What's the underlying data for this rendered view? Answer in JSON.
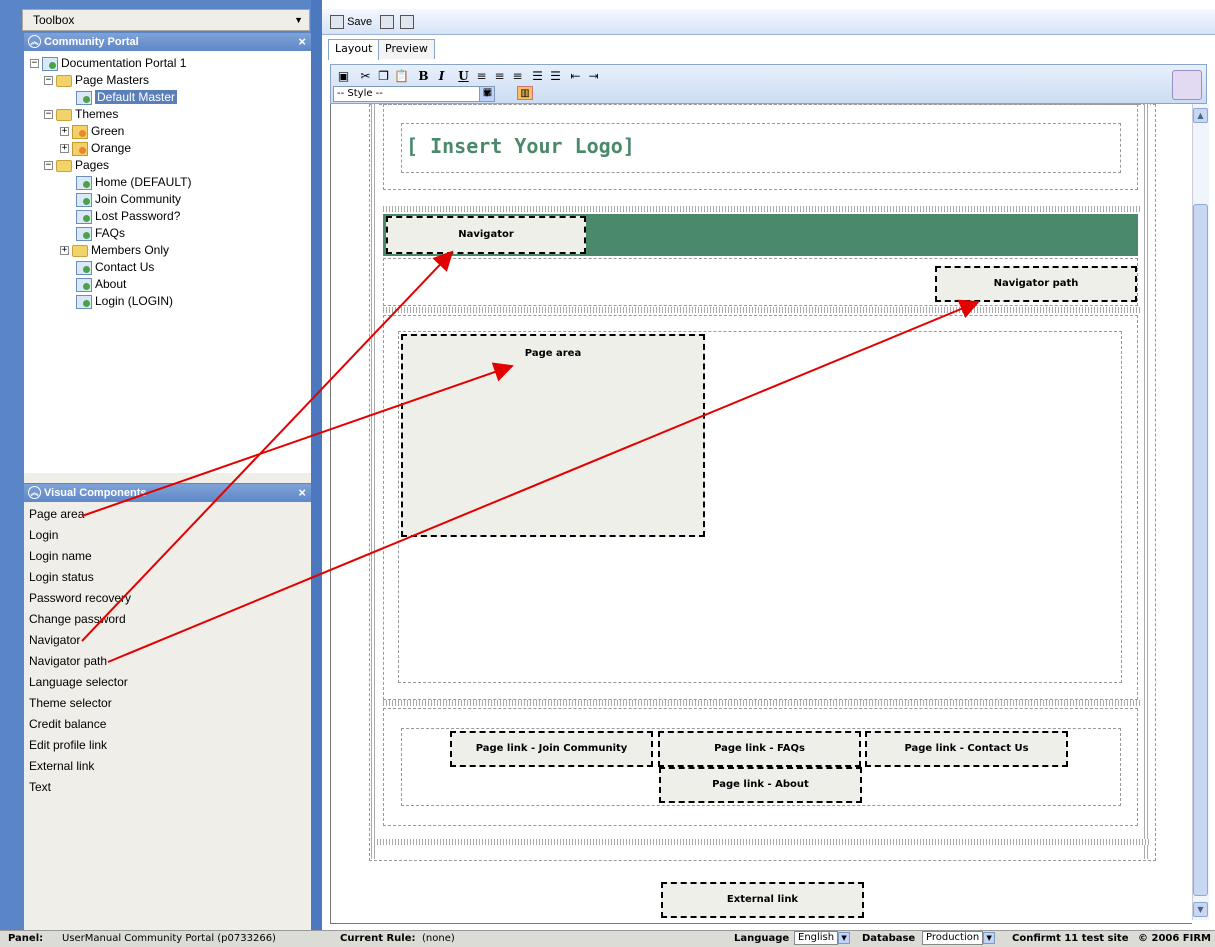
{
  "toolbox": {
    "label": "Toolbox"
  },
  "community_panel": {
    "title": "Community Portal",
    "tree": [
      {
        "label": "Documentation Portal 1"
      },
      {
        "label": "Page Masters"
      },
      {
        "label": "Default Master"
      },
      {
        "label": "Themes"
      },
      {
        "label": "Green"
      },
      {
        "label": "Orange"
      },
      {
        "label": "Pages"
      },
      {
        "label": "Home (DEFAULT)"
      },
      {
        "label": "Join Community"
      },
      {
        "label": "Lost Password?"
      },
      {
        "label": "FAQs"
      },
      {
        "label": "Members Only"
      },
      {
        "label": "Contact Us"
      },
      {
        "label": "About"
      },
      {
        "label": "Login (LOGIN)"
      }
    ]
  },
  "visual_components": {
    "title": "Visual Components",
    "items": [
      "Page area",
      "Login",
      "Login name",
      "Login status",
      "Password recovery",
      "Change password",
      "Navigator",
      "Navigator path",
      "Language selector",
      "Theme selector",
      "Credit balance",
      "Edit profile link",
      "External link",
      "Text"
    ]
  },
  "toolbar": {
    "save_label": "Save"
  },
  "tabs": [
    {
      "label": "Layout"
    },
    {
      "label": "Preview"
    }
  ],
  "editor_toolbar": {
    "style_value": "-- Style --"
  },
  "canvas": {
    "logo_text": "[ Insert Your Logo]",
    "navigator": "Navigator",
    "navigator_path": "Navigator path",
    "page_area": "Page area",
    "links": [
      "Page link - Join Community",
      "Page link - FAQs",
      "Page link - Contact Us",
      "Page link - About"
    ],
    "external_link": "External link",
    "nav_bar_color": "#4a8a6a",
    "logo_color": "#4a8a6a"
  },
  "status_bar": {
    "panel_label": "Panel:",
    "panel_value": "UserManual Community Portal (p0733266)",
    "rule_label": "Current Rule:",
    "rule_value": "(none)",
    "language_label": "Language",
    "language_value": "English",
    "database_label": "Database",
    "database_value": "Production",
    "site": "Confirmt 11 test site",
    "copyright": "© 2006 FIRM"
  }
}
